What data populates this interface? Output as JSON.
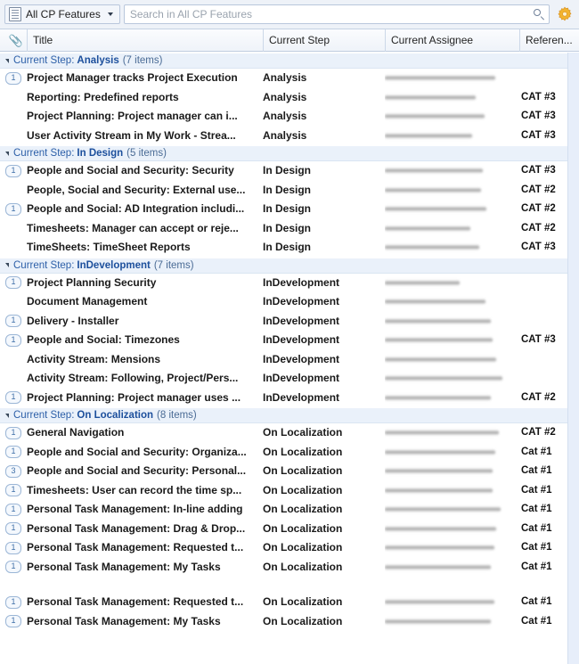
{
  "toolbar": {
    "scope_label": "All CP Features",
    "scope_icon": "list-icon",
    "dropdown_icon": "chevron-down-icon",
    "search_value": "",
    "search_placeholder": "Search in All CP Features",
    "search_icon": "search-icon",
    "settings_icon": "gear-icon",
    "accent_color": "#f0a929"
  },
  "columns": {
    "attachment_icon": "paperclip-icon",
    "title": "Title",
    "current_step": "Current Step",
    "current_assignee": "Current Assignee",
    "reference": "Referen..."
  },
  "groups": [
    {
      "field": "Current Step:",
      "value": "Analysis",
      "count": "(7 items)",
      "rows": [
        {
          "badge": "1",
          "title": "Project Manager tracks Project Execution",
          "step": "Analysis",
          "assignee_redacted": true,
          "assignee_width": 124,
          "ref": ""
        },
        {
          "badge": "",
          "title": "Reporting: Predefined reports",
          "step": "Analysis",
          "assignee_redacted": true,
          "assignee_width": 102,
          "ref": "CAT #3"
        },
        {
          "badge": "",
          "title": "Project Planning: Project manager can i...",
          "step": "Analysis",
          "assignee_redacted": true,
          "assignee_width": 112,
          "ref": "CAT #3"
        },
        {
          "badge": "",
          "title": "User Activity Stream in My Work - Strea...",
          "step": "Analysis",
          "assignee_redacted": true,
          "assignee_width": 98,
          "ref": "CAT #3"
        }
      ]
    },
    {
      "field": "Current Step:",
      "value": "In Design",
      "count": "(5 items)",
      "rows": [
        {
          "badge": "1",
          "title": "People and Social and Security: Security",
          "step": "In Design",
          "assignee_redacted": true,
          "assignee_width": 110,
          "ref": "CAT #3"
        },
        {
          "badge": "",
          "title": "People, Social and Security: External use...",
          "step": "In Design",
          "assignee_redacted": true,
          "assignee_width": 108,
          "ref": "CAT #2"
        },
        {
          "badge": "1",
          "title": "People and Social: AD Integration includi...",
          "step": "In Design",
          "assignee_redacted": true,
          "assignee_width": 114,
          "ref": "CAT #2"
        },
        {
          "badge": "",
          "title": "Timesheets: Manager can accept or reje...",
          "step": "In Design",
          "assignee_redacted": true,
          "assignee_width": 96,
          "ref": "CAT #2"
        },
        {
          "badge": "",
          "title": "TimeSheets: TimeSheet Reports",
          "step": "In Design",
          "assignee_redacted": true,
          "assignee_width": 106,
          "ref": "CAT #3"
        }
      ]
    },
    {
      "field": "Current Step:",
      "value": "InDevelopment",
      "count": "(7 items)",
      "rows": [
        {
          "badge": "1",
          "title": "Project Planning Security",
          "step": "InDevelopment",
          "assignee_redacted": true,
          "assignee_width": 84,
          "ref": ""
        },
        {
          "badge": "",
          "title": "Document Management",
          "step": "InDevelopment",
          "assignee_redacted": true,
          "assignee_width": 113,
          "ref": ""
        },
        {
          "badge": "1",
          "title": "Delivery - Installer",
          "step": "InDevelopment",
          "assignee_redacted": true,
          "assignee_width": 119,
          "ref": ""
        },
        {
          "badge": "1",
          "title": "People and Social: Timezones",
          "step": "InDevelopment",
          "assignee_redacted": true,
          "assignee_width": 121,
          "ref": "CAT #3"
        },
        {
          "badge": "",
          "title": "Activity Stream: Mensions",
          "step": "InDevelopment",
          "assignee_redacted": true,
          "assignee_width": 125,
          "ref": ""
        },
        {
          "badge": "",
          "title": "Activity Stream: Following, Project/Pers...",
          "step": "InDevelopment",
          "assignee_redacted": true,
          "assignee_width": 132,
          "ref": ""
        },
        {
          "badge": "1",
          "title": "Project Planning: Project manager uses ...",
          "step": "InDevelopment",
          "assignee_redacted": true,
          "assignee_width": 119,
          "ref": "CAT #2"
        }
      ]
    },
    {
      "field": "Current Step:",
      "value": "On Localization",
      "count": "(8 items)",
      "rows": [
        {
          "badge": "1",
          "title": "General Navigation",
          "step": "On Localization",
          "assignee_redacted": true,
          "assignee_width": 128,
          "ref": "CAT #2"
        },
        {
          "badge": "1",
          "title": "People and Social and Security: Organiza...",
          "step": "On Localization",
          "assignee_redacted": true,
          "assignee_width": 124,
          "ref": "Cat #1"
        },
        {
          "badge": "3",
          "title": "People and Social and Security: Personal...",
          "step": "On Localization",
          "assignee_redacted": true,
          "assignee_width": 121,
          "ref": "Cat #1"
        },
        {
          "badge": "1",
          "title": "Timesheets: User can record the time sp...",
          "step": "On Localization",
          "assignee_redacted": true,
          "assignee_width": 121,
          "ref": "Cat #1"
        },
        {
          "badge": "1",
          "title": "Personal Task Management: In-line adding",
          "step": "On Localization",
          "assignee_redacted": true,
          "assignee_width": 130,
          "ref": "Cat #1"
        },
        {
          "badge": "1",
          "title": "Personal Task Management: Drag & Drop...",
          "step": "On Localization",
          "assignee_redacted": true,
          "assignee_width": 125,
          "ref": "Cat #1"
        },
        {
          "badge": "1",
          "title": "Personal Task Management: Requested t...",
          "step": "On Localization",
          "assignee_redacted": true,
          "assignee_width": 123,
          "ref": "Cat #1"
        },
        {
          "badge": "1",
          "title": "Personal Task Management: My Tasks",
          "step": "On Localization",
          "assignee_redacted": true,
          "assignee_width": 119,
          "ref": "Cat #1"
        }
      ]
    }
  ],
  "trailing_rows": [
    {
      "badge": "1",
      "title": "Personal Task Management: Requested t...",
      "step": "On Localization",
      "assignee_redacted": true,
      "assignee_width": 123,
      "ref": "Cat #1"
    },
    {
      "badge": "1",
      "title": "Personal Task Management: My Tasks",
      "step": "On Localization",
      "assignee_redacted": true,
      "assignee_width": 119,
      "ref": "Cat #1"
    }
  ]
}
